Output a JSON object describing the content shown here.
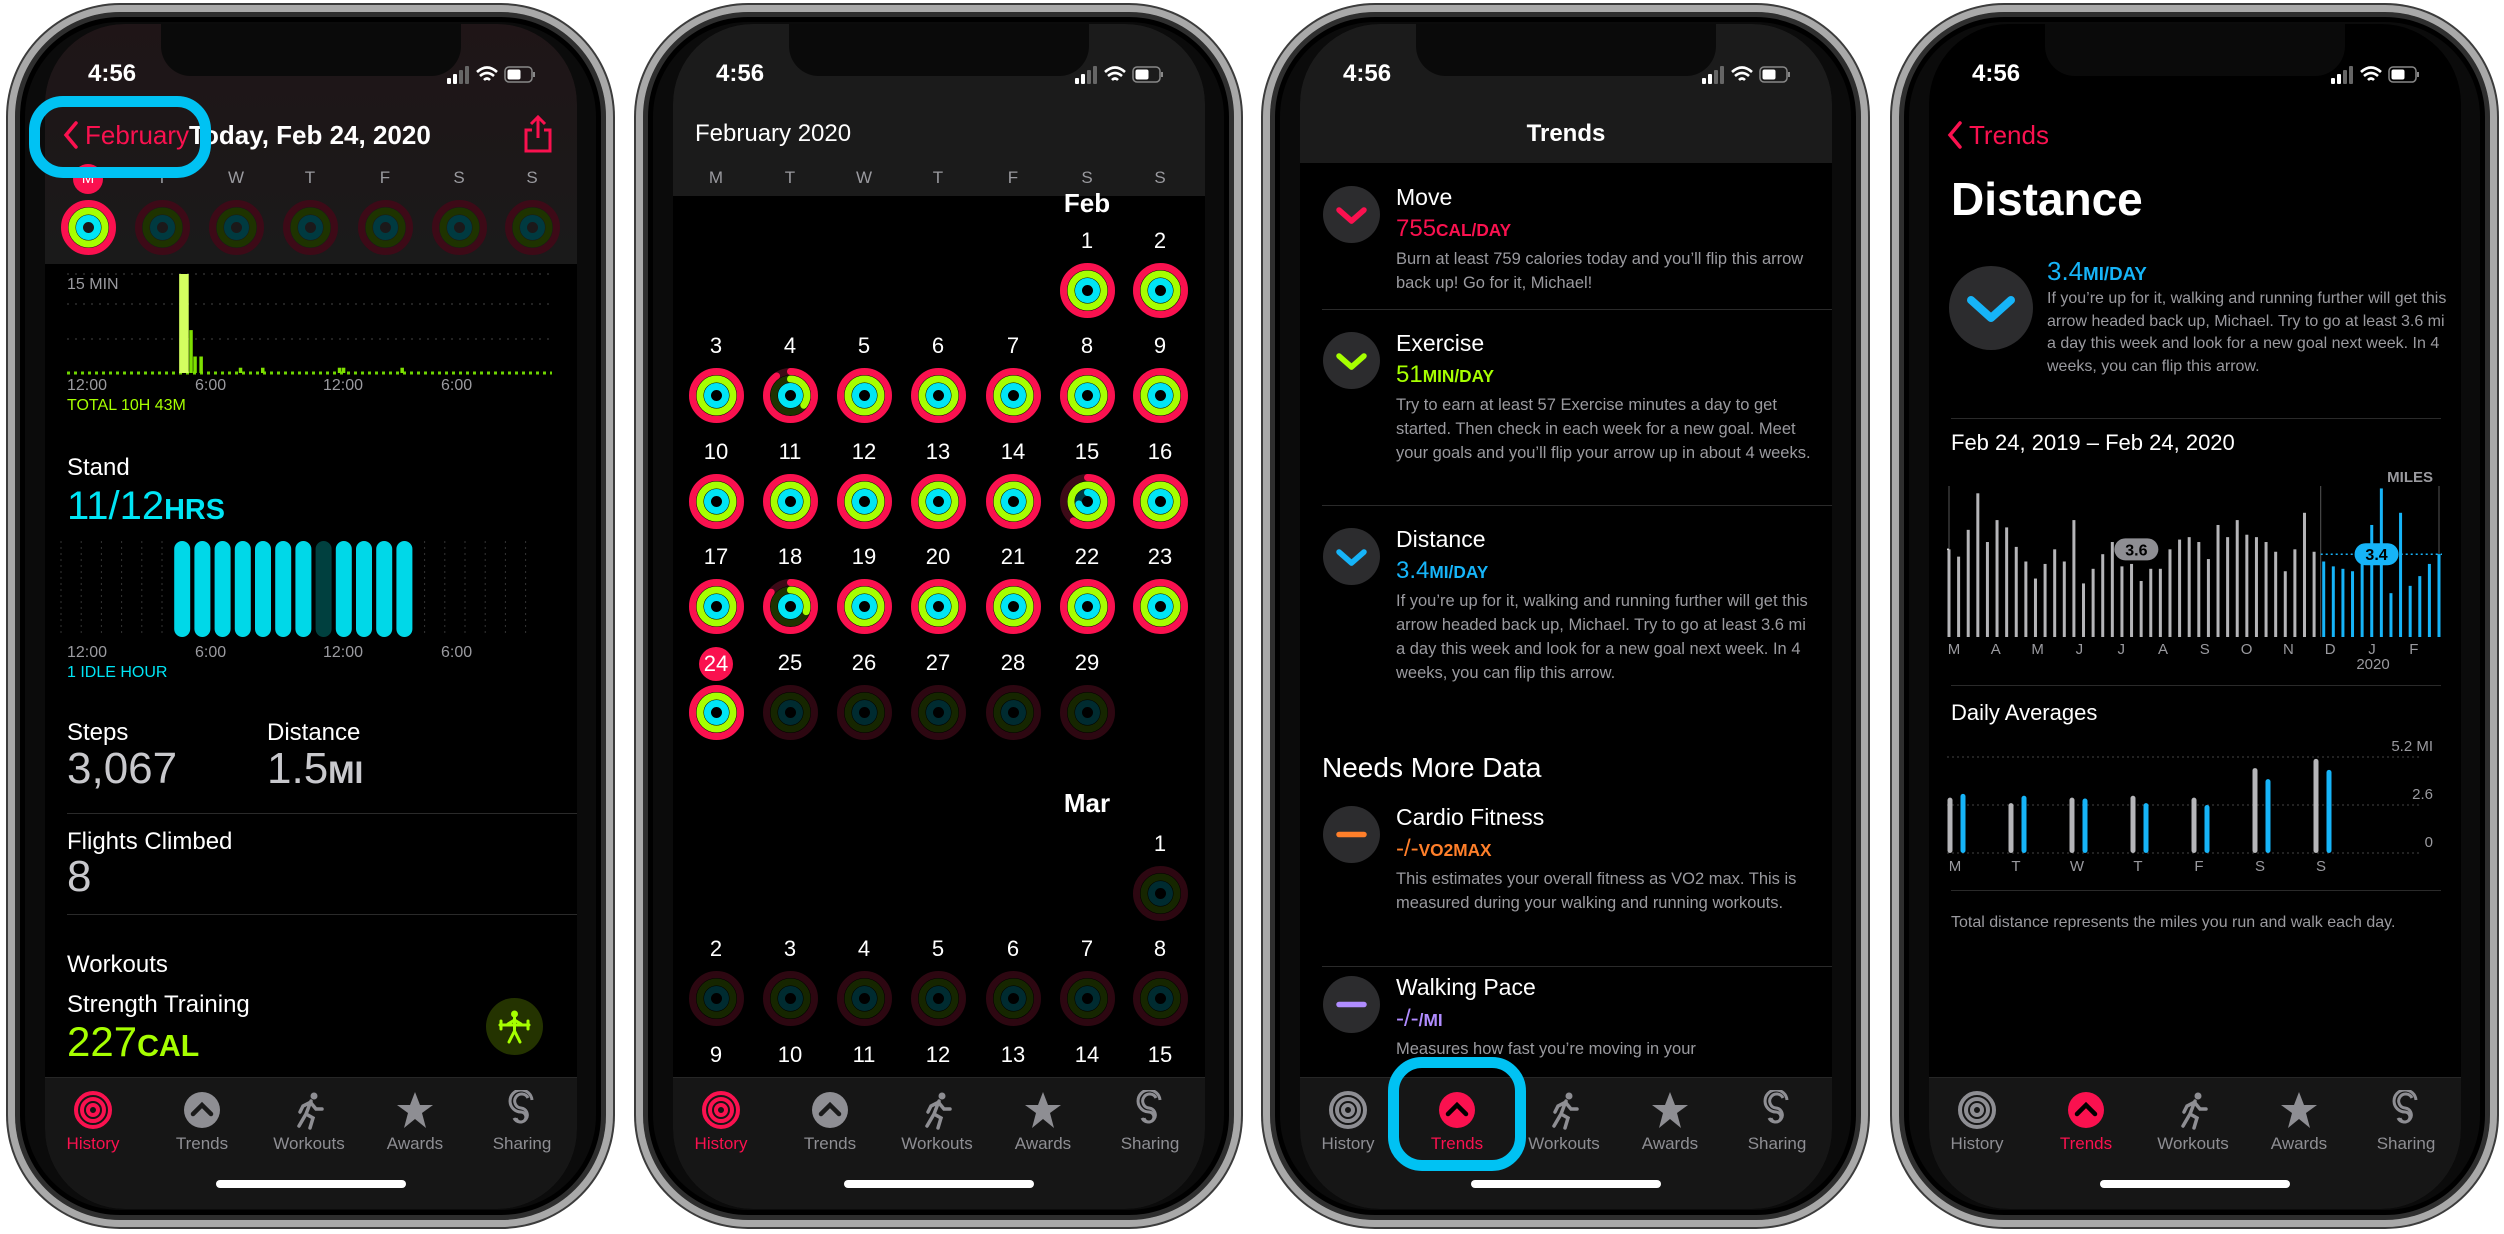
{
  "status": {
    "time": "4:56"
  },
  "tabs": [
    {
      "label": "History",
      "icon": "history-rings-icon"
    },
    {
      "label": "Trends",
      "icon": "trends-arrow-icon"
    },
    {
      "label": "Workouts",
      "icon": "running-figure-icon"
    },
    {
      "label": "Awards",
      "icon": "award-star-icon"
    },
    {
      "label": "Sharing",
      "icon": "sharing-icon"
    }
  ],
  "colors": {
    "move": "#fa114f",
    "exercise": "#a6ff00",
    "stand": "#00e5f5",
    "distance": "#16b4f8",
    "cardio": "#ff7f2a",
    "pace": "#b08cff",
    "highlight": "#00c2f3"
  },
  "day": {
    "active_tab": 0,
    "back_label": "February",
    "title": "Today, Feb 24, 2020",
    "weekdays": [
      "M",
      "T",
      "W",
      "T",
      "F",
      "S",
      "S"
    ],
    "week_rings": [
      [
        1,
        1,
        1
      ],
      [
        0,
        0,
        0
      ],
      [
        0,
        0,
        0
      ],
      [
        0,
        0,
        0
      ],
      [
        0,
        0,
        0
      ],
      [
        0,
        0,
        0
      ],
      [
        0,
        0,
        0
      ]
    ],
    "exercise_chart": {
      "max_label": "15 MIN",
      "x_labels": [
        "12:00",
        "6:00",
        "12:00",
        "6:00"
      ],
      "bars": [
        [
          5.55,
          15
        ],
        [
          5.7,
          15
        ],
        [
          5.85,
          15
        ],
        [
          6.05,
          6.5
        ],
        [
          6.25,
          2.5
        ],
        [
          6.55,
          2.5
        ],
        [
          8.5,
          0.8
        ],
        [
          9.6,
          0.8
        ],
        [
          13.4,
          0.8
        ],
        [
          13.6,
          0.8
        ],
        [
          16.5,
          0.8
        ]
      ],
      "total": "TOTAL 10H 43M"
    },
    "stand": {
      "label": "Stand",
      "value": "11/12",
      "unit": "HRS",
      "stood_hours": [
        6,
        7,
        8,
        9,
        10,
        11,
        12,
        14,
        15,
        16,
        17
      ],
      "idle_hours": [
        13
      ],
      "x_labels": [
        "12:00",
        "6:00",
        "12:00",
        "6:00"
      ],
      "note": "1 IDLE HOUR"
    },
    "steps": {
      "label": "Steps",
      "value": "3,067"
    },
    "distance": {
      "label": "Distance",
      "value": "1.5",
      "unit": "MI"
    },
    "flights": {
      "label": "Flights Climbed",
      "value": "8"
    },
    "workouts": {
      "label": "Workouts",
      "name": "Strength Training",
      "value": "227",
      "unit": "CAL"
    }
  },
  "calendar": {
    "active_tab": 0,
    "title": "February 2020",
    "weekdays": [
      "M",
      "T",
      "W",
      "T",
      "F",
      "S",
      "S"
    ],
    "month1": "Feb",
    "month2": "Mar",
    "feb_rows": [
      [
        null,
        null,
        null,
        null,
        null,
        {
          "d": "1",
          "r": [
            1,
            1,
            1
          ]
        },
        {
          "d": "2",
          "r": [
            1,
            1,
            1
          ]
        }
      ],
      [
        {
          "d": "3",
          "r": [
            1,
            1,
            1
          ]
        },
        {
          "d": "4",
          "r": [
            0.9,
            0.35,
            1
          ]
        },
        {
          "d": "5",
          "r": [
            1,
            1,
            1
          ]
        },
        {
          "d": "6",
          "r": [
            1,
            1,
            1
          ]
        },
        {
          "d": "7",
          "r": [
            1,
            1,
            1
          ]
        },
        {
          "d": "8",
          "r": [
            1,
            1,
            1
          ]
        },
        {
          "d": "9",
          "r": [
            1,
            1,
            1
          ]
        }
      ],
      [
        {
          "d": "10",
          "r": [
            1,
            1,
            1
          ]
        },
        {
          "d": "11",
          "r": [
            1,
            1,
            1
          ]
        },
        {
          "d": "12",
          "r": [
            1,
            1,
            1
          ]
        },
        {
          "d": "13",
          "r": [
            1,
            1,
            1
          ]
        },
        {
          "d": "14",
          "r": [
            1,
            1,
            1
          ]
        },
        {
          "d": "15",
          "r": [
            0.6,
            1,
            0.7
          ]
        },
        {
          "d": "16",
          "r": [
            1,
            1,
            1
          ]
        }
      ],
      [
        {
          "d": "17",
          "r": [
            1,
            1,
            1
          ]
        },
        {
          "d": "18",
          "r": [
            0.85,
            0.3,
            1
          ]
        },
        {
          "d": "19",
          "r": [
            1,
            1,
            1
          ]
        },
        {
          "d": "20",
          "r": [
            1,
            1,
            1
          ]
        },
        {
          "d": "21",
          "r": [
            1,
            1,
            1
          ]
        },
        {
          "d": "22",
          "r": [
            1,
            1,
            1
          ]
        },
        {
          "d": "23",
          "r": [
            1,
            1,
            1
          ]
        }
      ],
      [
        {
          "d": "24",
          "r": [
            1,
            1,
            1
          ],
          "today": true
        },
        {
          "d": "25",
          "r": [
            0,
            0,
            0
          ]
        },
        {
          "d": "26",
          "r": [
            0,
            0,
            0
          ]
        },
        {
          "d": "27",
          "r": [
            0,
            0,
            0
          ]
        },
        {
          "d": "28",
          "r": [
            0,
            0,
            0
          ]
        },
        {
          "d": "29",
          "r": [
            0,
            0,
            0
          ]
        },
        null
      ]
    ],
    "mar_rows": [
      [
        null,
        null,
        null,
        null,
        null,
        null,
        {
          "d": "1",
          "r": [
            0,
            0,
            0
          ]
        }
      ],
      [
        {
          "d": "2",
          "r": [
            0,
            0,
            0
          ]
        },
        {
          "d": "3",
          "r": [
            0,
            0,
            0
          ]
        },
        {
          "d": "4",
          "r": [
            0,
            0,
            0
          ]
        },
        {
          "d": "5",
          "r": [
            0,
            0,
            0
          ]
        },
        {
          "d": "6",
          "r": [
            0,
            0,
            0
          ]
        },
        {
          "d": "7",
          "r": [
            0,
            0,
            0
          ]
        },
        {
          "d": "8",
          "r": [
            0,
            0,
            0
          ]
        }
      ],
      [
        {
          "d": "9"
        },
        {
          "d": "10"
        },
        {
          "d": "11"
        },
        {
          "d": "12"
        },
        {
          "d": "13"
        },
        {
          "d": "14"
        },
        {
          "d": "15"
        }
      ]
    ]
  },
  "trends": {
    "active_tab": 1,
    "title": "Trends",
    "items": [
      {
        "name": "Move",
        "value": "755",
        "unit": "CAL/DAY",
        "color": "#fa114f",
        "arrow": "down",
        "desc": "Burn at least 759 calories today and you’ll flip this arrow back up! Go for it, Michael!"
      },
      {
        "name": "Exercise",
        "value": "51",
        "unit": "MIN/DAY",
        "color": "#a6ff00",
        "arrow": "down",
        "desc": "Try to earn at least 57 Exercise minutes a day to get started. Then check in each week for a new goal. Meet your goals and you’ll flip your arrow up in about 4 weeks."
      },
      {
        "name": "Distance",
        "value": "3.4",
        "unit": "MI/DAY",
        "color": "#16b4f8",
        "arrow": "down",
        "desc": "If you’re up for it, walking and running further will get this arrow headed back up, Michael. Try to go at least 3.6 mi a day this week and look for a new goal next week. In 4 weeks, you can flip this arrow."
      }
    ],
    "section": "Needs More Data",
    "more": [
      {
        "name": "Cardio Fitness",
        "value": "-/-",
        "unit": "VO2MAX",
        "color": "#ff7f2a",
        "arrow": "flat",
        "desc": "This estimates your overall fitness as VO2 max. This is measured during your walking and running workouts."
      },
      {
        "name": "Walking Pace",
        "value": "-/-",
        "unit": "/MI",
        "color": "#b08cff",
        "arrow": "flat",
        "desc": "Measures how fast you’re moving in your"
      }
    ]
  },
  "distance": {
    "active_tab": 1,
    "back_label": "Trends",
    "title": "Distance",
    "value": "3.4",
    "unit": "MI/DAY",
    "desc": "If you’re up for it, walking and running further will get this arrow headed back up, Michael. Try to go at least 3.6 mi a day this week and look for a new goal next week. In 4 weeks, you can flip this arrow.",
    "range": "Feb 24, 2019 – Feb 24, 2020",
    "daily_title": "Daily Averages",
    "footer": "Total distance represents the miles you run and walk each day."
  },
  "chart_data": [
    {
      "type": "bar",
      "title": "Feb 24, 2019 – Feb 24, 2020",
      "ylabel": "MILES",
      "ylim": [
        0,
        6.2
      ],
      "x_tick_labels": [
        "M",
        "A",
        "M",
        "J",
        "J",
        "A",
        "S",
        "O",
        "N",
        "D",
        "J",
        "F"
      ],
      "year_label": "2020",
      "series": [
        {
          "name": "365-day",
          "color": "#b5b5b8",
          "values": [
            3.6,
            3.3,
            4.4,
            5.9,
            3.9,
            4.8,
            4.5,
            3.7,
            3.1,
            2.4,
            3.0,
            3.6,
            3.1,
            4.8,
            2.2,
            2.8,
            3.4,
            3.9,
            2.9,
            3.0,
            2.3,
            2.8,
            2.8,
            3.6,
            4.0,
            4.1,
            3.9,
            3.2,
            4.6,
            4.1,
            4.8,
            4.2,
            4.1,
            3.9,
            3.5,
            2.7,
            3.6,
            5.1,
            3.5
          ],
          "average": 3.6,
          "average_label": "3.6"
        },
        {
          "name": "90-day",
          "color": "#16b4f8",
          "values": [
            3.1,
            2.9,
            2.8,
            2.7,
            3.1,
            4.6,
            6.1,
            1.8,
            5.1,
            2.1,
            2.5,
            3.0,
            3.4
          ],
          "average": 3.4,
          "average_label": "3.4"
        }
      ]
    },
    {
      "type": "bar",
      "title": "Daily Averages",
      "categories": [
        "M",
        "T",
        "W",
        "T",
        "F",
        "S",
        "S"
      ],
      "y_ticks": [
        "5.2 MI",
        "2.6",
        "0"
      ],
      "ylim": [
        0,
        5.2
      ],
      "series": [
        {
          "color": "#b5b5b8",
          "values": [
            3.0,
            2.7,
            3.0,
            3.1,
            3.0,
            4.6,
            5.1
          ]
        },
        {
          "color": "#16b4f8",
          "values": [
            3.2,
            3.1,
            2.95,
            2.7,
            2.6,
            4.0,
            4.5
          ]
        }
      ]
    }
  ]
}
